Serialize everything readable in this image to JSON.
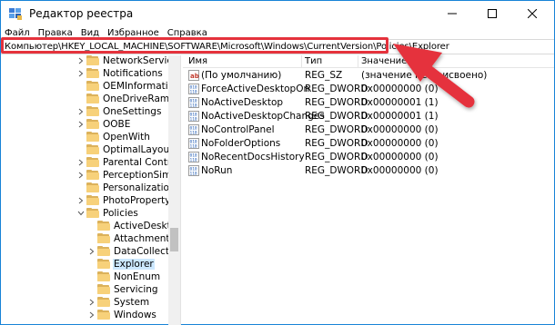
{
  "window": {
    "title": "Редактор реестра"
  },
  "menu": [
    "Файл",
    "Правка",
    "Вид",
    "Избранное",
    "Справка"
  ],
  "address": {
    "path": "Компьютер\\HKEY_LOCAL_MACHINE\\SOFTWARE\\Microsoft\\Windows\\CurrentVersion\\Policies\\Explorer"
  },
  "tree": {
    "items": [
      {
        "label": "NetworkServiceTrigg",
        "expandable": true,
        "selected": false
      },
      {
        "label": "Notifications",
        "expandable": true,
        "selected": false
      },
      {
        "label": "OEMInformation",
        "expandable": false,
        "selected": false
      },
      {
        "label": "OneDriveRamps",
        "expandable": false,
        "selected": false
      },
      {
        "label": "OneSettings",
        "expandable": true,
        "selected": false
      },
      {
        "label": "OOBE",
        "expandable": true,
        "selected": false
      },
      {
        "label": "OpenWith",
        "expandable": false,
        "selected": false
      },
      {
        "label": "OptimalLayout",
        "expandable": false,
        "selected": false
      },
      {
        "label": "Parental Controls",
        "expandable": true,
        "selected": false
      },
      {
        "label": "PerceptionSimulatio",
        "expandable": true,
        "selected": false
      },
      {
        "label": "Personalization",
        "expandable": false,
        "selected": false
      },
      {
        "label": "PhotoPropertyHand",
        "expandable": true,
        "selected": false
      },
      {
        "label": "Policies",
        "expandable": true,
        "expanded": true,
        "selected": false
      },
      {
        "label": "ActiveDesktop",
        "expandable": false,
        "selected": false
      },
      {
        "label": "Attachments",
        "expandable": false,
        "selected": false
      },
      {
        "label": "DataCollection",
        "expandable": true,
        "selected": false
      },
      {
        "label": "Explorer",
        "expandable": false,
        "selected": true
      },
      {
        "label": "NonEnum",
        "expandable": false,
        "selected": false
      },
      {
        "label": "Servicing",
        "expandable": false,
        "selected": false
      },
      {
        "label": "System",
        "expandable": true,
        "selected": false
      },
      {
        "label": "Windows",
        "expandable": true,
        "selected": false
      }
    ]
  },
  "list": {
    "columns": [
      "Имя",
      "Тип",
      "Значение"
    ],
    "rows": [
      {
        "icon": "string-value-icon",
        "name": "(По умолчанию)",
        "type": "REG_SZ",
        "value": "(значение не присвоено)"
      },
      {
        "icon": "dword-value-icon",
        "name": "ForceActiveDesktopOn",
        "type": "REG_DWORD",
        "value": "0x00000000 (0)"
      },
      {
        "icon": "dword-value-icon",
        "name": "NoActiveDesktop",
        "type": "REG_DWORD",
        "value": "0x00000001 (1)"
      },
      {
        "icon": "dword-value-icon",
        "name": "NoActiveDesktopChanges",
        "type": "REG_DWORD",
        "value": "0x00000001 (1)"
      },
      {
        "icon": "dword-value-icon",
        "name": "NoControlPanel",
        "type": "REG_DWORD",
        "value": "0x00000000 (0)"
      },
      {
        "icon": "dword-value-icon",
        "name": "NoFolderOptions",
        "type": "REG_DWORD",
        "value": "0x00000000 (0)"
      },
      {
        "icon": "dword-value-icon",
        "name": "NoRecentDocsHistory",
        "type": "REG_DWORD",
        "value": "0x00000000 (0)"
      },
      {
        "icon": "dword-value-icon",
        "name": "NoRun",
        "type": "REG_DWORD",
        "value": "0x00000000 (0)"
      }
    ]
  },
  "colors": {
    "accent_border": "#1883d7",
    "highlight_red": "#e5323c",
    "selection": "#cce8ff",
    "folder": "#f7d17a"
  }
}
